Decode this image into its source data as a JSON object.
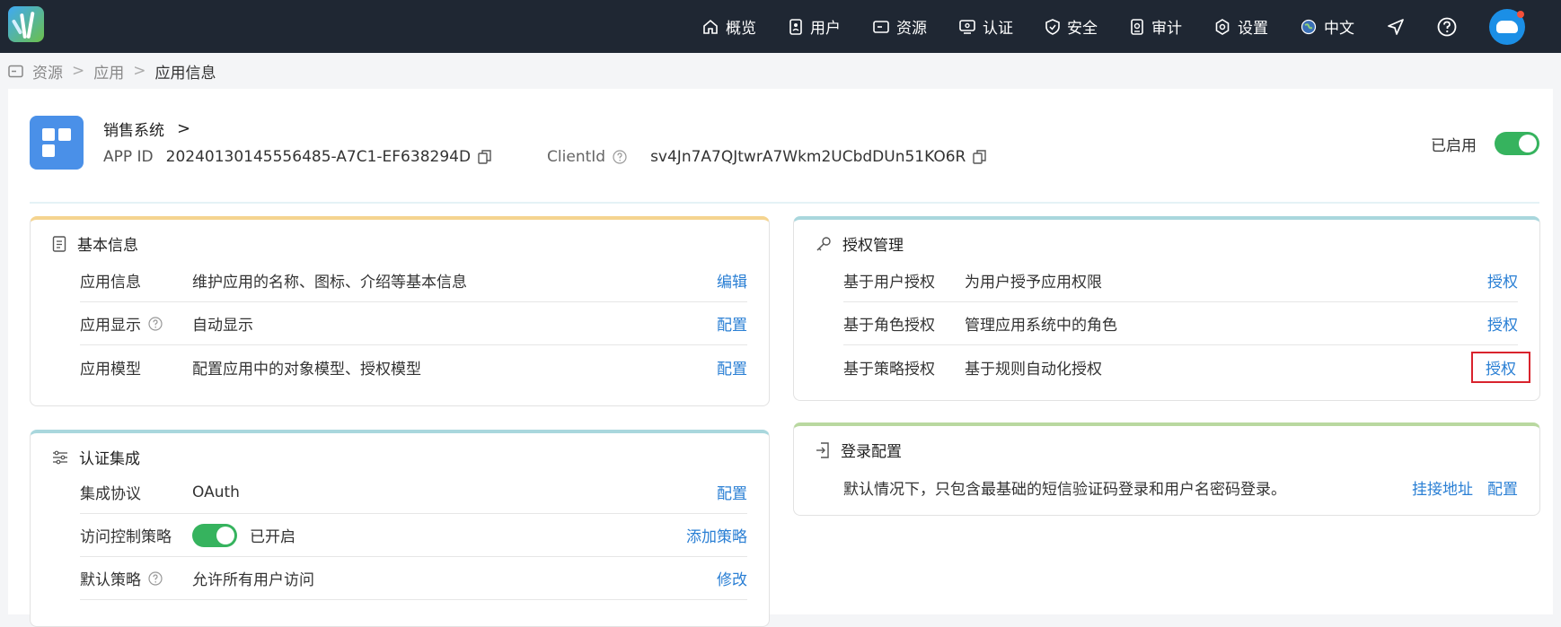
{
  "nav": {
    "items": [
      {
        "label": "概览",
        "icon": "home-icon"
      },
      {
        "label": "用户",
        "icon": "user-icon"
      },
      {
        "label": "资源",
        "icon": "resource-icon"
      },
      {
        "label": "认证",
        "icon": "auth-icon"
      },
      {
        "label": "安全",
        "icon": "shield-icon"
      },
      {
        "label": "审计",
        "icon": "audit-icon"
      },
      {
        "label": "设置",
        "icon": "settings-icon"
      },
      {
        "label": "中文",
        "icon": "globe-icon"
      }
    ]
  },
  "breadcrumb": {
    "items": [
      "资源",
      "应用",
      "应用信息"
    ]
  },
  "app": {
    "name": "销售系统",
    "app_id_label": "APP ID",
    "app_id": "20240130145556485-A7C1-EF638294D",
    "client_id_label": "ClientId",
    "client_id": "sv4Jn7A7QJtwrA7Wkm2UCbdDUn51KO6R",
    "status_label": "已启用"
  },
  "basic": {
    "title": "基本信息",
    "rows": [
      {
        "key": "应用信息",
        "value": "维护应用的名称、图标、介绍等基本信息",
        "action": "编辑"
      },
      {
        "key": "应用显示",
        "value": "自动显示",
        "action": "配置"
      },
      {
        "key": "应用模型",
        "value": "配置应用中的对象模型、授权模型",
        "action": "配置"
      }
    ]
  },
  "auth_integration": {
    "title": "认证集成",
    "rows": [
      {
        "key": "集成协议",
        "value": "OAuth",
        "action": "配置"
      },
      {
        "key": "访问控制策略",
        "value": "已开启",
        "action": "添加策略"
      },
      {
        "key": "默认策略",
        "value": "允许所有用户访问",
        "action": "修改"
      }
    ]
  },
  "authorization": {
    "title": "授权管理",
    "rows": [
      {
        "key": "基于用户授权",
        "value": "为用户授予应用权限",
        "action": "授权"
      },
      {
        "key": "基于角色授权",
        "value": "管理应用系统中的角色",
        "action": "授权"
      },
      {
        "key": "基于策略授权",
        "value": "基于规则自动化授权",
        "action": "授权"
      }
    ]
  },
  "login_config": {
    "title": "登录配置",
    "description": "默认情况下，只包含最基础的短信验证码登录和用户名密码登录。",
    "action_mount": "挂接地址",
    "action_config": "配置"
  },
  "colors": {
    "topbar": "#1f2733",
    "link": "#2a7fd4",
    "switch_on": "#36b35e",
    "basic_accent": "#f5d48f",
    "auth_accent": "#a9d7dd",
    "login_accent": "#b9d8a0",
    "highlight_box": "#d9232d"
  }
}
